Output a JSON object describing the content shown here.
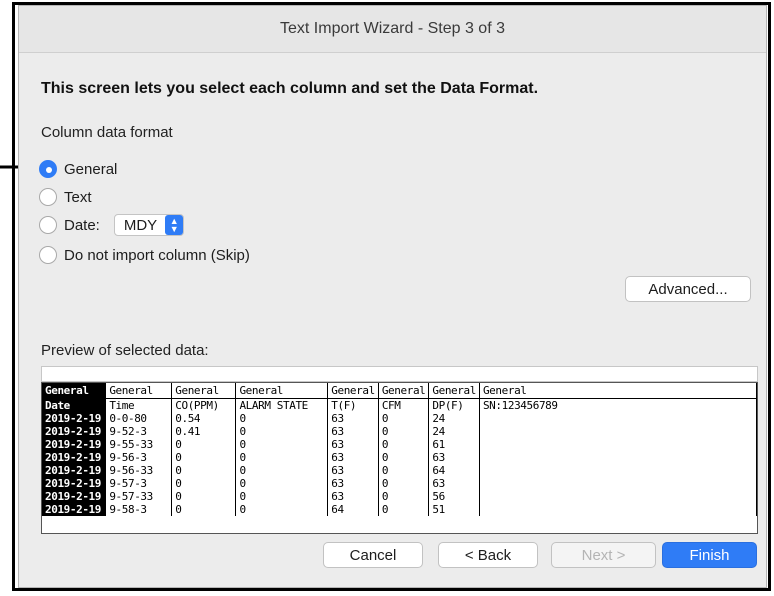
{
  "window": {
    "title": "Text Import Wizard - Step 3 of 3"
  },
  "instructions": "This screen lets you select each column and set the Data Format.",
  "column_format": {
    "label": "Column data format",
    "options": {
      "general": "General",
      "text": "Text",
      "date": "Date:",
      "skip": "Do not import column (Skip)"
    },
    "selected": "general",
    "date_format": "MDY"
  },
  "buttons": {
    "advanced": "Advanced...",
    "cancel": "Cancel",
    "back": "< Back",
    "next": "Next >",
    "finish": "Finish"
  },
  "preview": {
    "label": "Preview of selected data:",
    "headers": [
      "General",
      "General",
      "General",
      "General",
      "General",
      "General",
      "General",
      "General"
    ],
    "rows": [
      [
        "Date",
        "Time",
        "CO(PPM)",
        "ALARM STATE",
        "T(F)",
        "CFM",
        "DP(F)",
        "SN:123456789"
      ],
      [
        "2019-2-19",
        "0-0-80",
        "0.54",
        "0",
        "63",
        "0",
        "24",
        ""
      ],
      [
        "2019-2-19",
        "9-52-3",
        "0.41",
        "0",
        "63",
        "0",
        "24",
        ""
      ],
      [
        "2019-2-19",
        "9-55-33",
        "0",
        "0",
        "63",
        "0",
        "61",
        ""
      ],
      [
        "2019-2-19",
        "9-56-3",
        "0",
        "0",
        "63",
        "0",
        "63",
        ""
      ],
      [
        "2019-2-19",
        "9-56-33",
        "0",
        "0",
        "63",
        "0",
        "64",
        ""
      ],
      [
        "2019-2-19",
        "9-57-3",
        "0",
        "0",
        "63",
        "0",
        "63",
        ""
      ],
      [
        "2019-2-19",
        "9-57-33",
        "0",
        "0",
        "63",
        "0",
        "56",
        ""
      ],
      [
        "2019-2-19",
        "9-58-3",
        "0",
        "0",
        "64",
        "0",
        "51",
        ""
      ]
    ]
  },
  "colors": {
    "accent": "#2f7cf6",
    "dialog_bg": "#ececec"
  }
}
